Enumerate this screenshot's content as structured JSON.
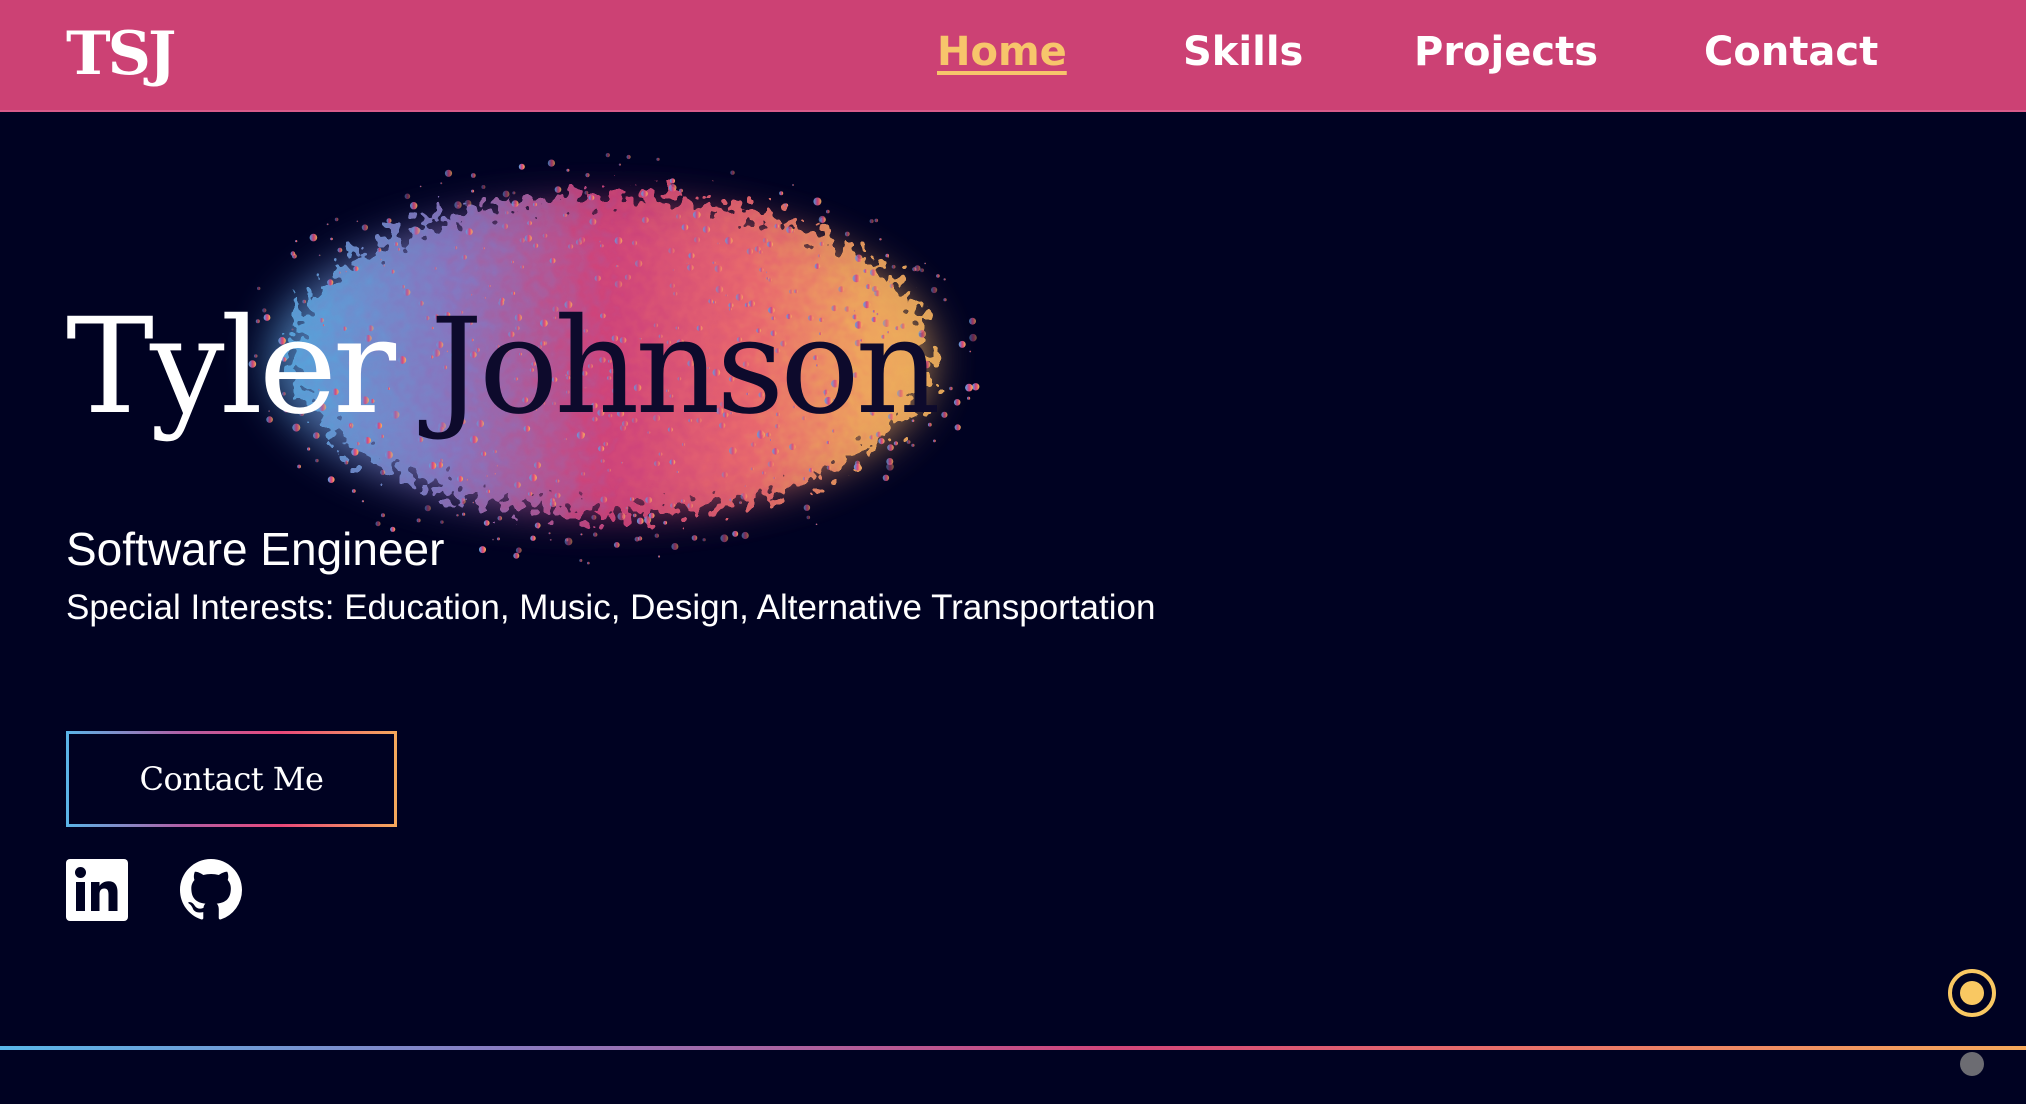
{
  "nav": {
    "logo": "TSJ",
    "links": [
      {
        "label": "Home",
        "active": true
      },
      {
        "label": "Skills",
        "active": false
      },
      {
        "label": "Projects",
        "active": false
      },
      {
        "label": "Contact",
        "active": false
      }
    ]
  },
  "hero": {
    "first_name": "Tyler",
    "last_name": "Johnson",
    "title": "Software Engineer",
    "interests": "Special Interests: Education, Music, Design, Alternative Transportation",
    "cta_label": "Contact Me"
  },
  "social": [
    {
      "icon": "linkedin-icon"
    },
    {
      "icon": "github-icon"
    }
  ],
  "scroll_indicator": {
    "sections": 2,
    "active_index": 0
  },
  "colors": {
    "navbar": "#cc4174",
    "background": "#000222",
    "accent": "#f7c56b",
    "gradient": [
      "#5ab5e8",
      "#b05fa6",
      "#e9487a",
      "#f5a95b"
    ]
  }
}
